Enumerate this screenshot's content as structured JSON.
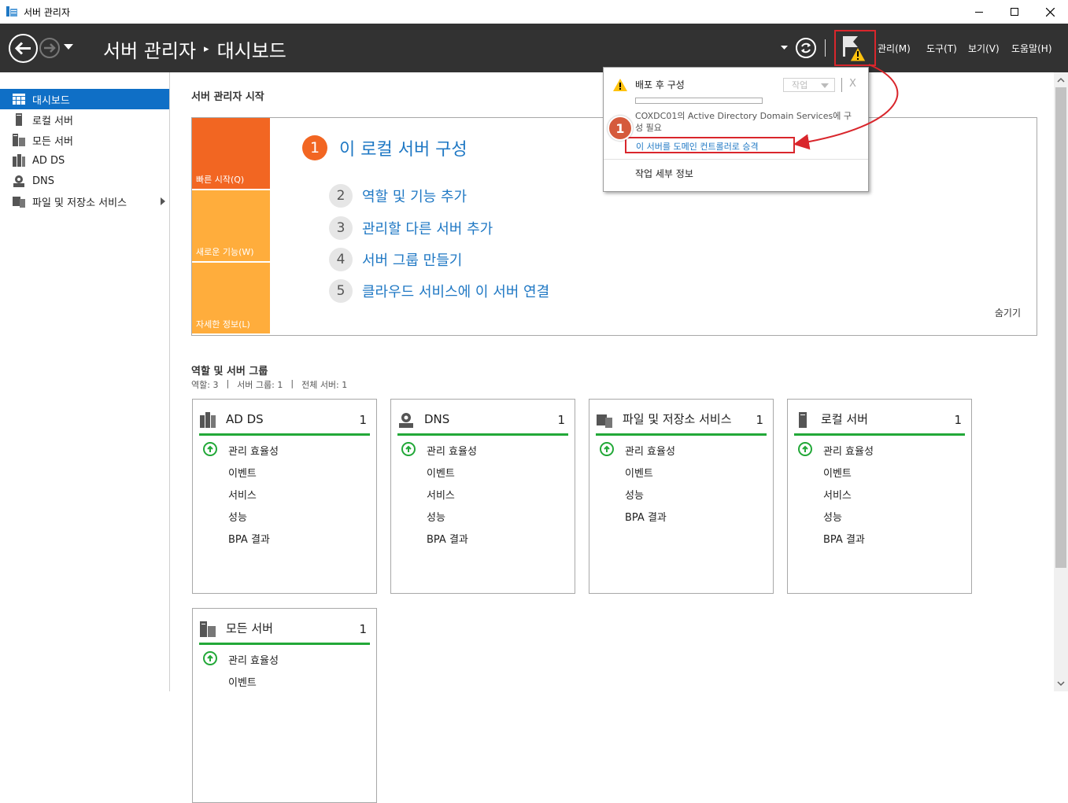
{
  "window": {
    "title": "서버 관리자",
    "minimize_icon": "minimize-icon",
    "maximize_icon": "maximize-icon",
    "close_icon": "close-icon"
  },
  "header": {
    "breadcrumb_root": "서버 관리자",
    "breadcrumb_separator": "▸",
    "breadcrumb_current": "대시보드",
    "menus": [
      "관리(M)",
      "도구(T)",
      "보기(V)",
      "도움말(H)"
    ],
    "background_color": "#323232"
  },
  "sidebar": {
    "items": [
      {
        "label": "대시보드",
        "icon": "dashboard-icon",
        "active": true
      },
      {
        "label": "로컬 서버",
        "icon": "local-server-icon",
        "active": false
      },
      {
        "label": "모든 서버",
        "icon": "all-servers-icon",
        "active": false
      },
      {
        "label": "AD DS",
        "icon": "ad-ds-icon",
        "active": false
      },
      {
        "label": "DNS",
        "icon": "dns-icon",
        "active": false
      },
      {
        "label": "파일 및 저장소 서비스",
        "icon": "file-storage-icon",
        "active": false
      }
    ],
    "active_color": "#0f6fc6"
  },
  "welcome": {
    "heading": "서버 관리자 시작",
    "tiles": {
      "quick_start": "빠른 시작(Q)",
      "whats_new": "새로운 기능(W)",
      "learn_more": "자세한 정보(L)"
    },
    "step1": {
      "num": "1",
      "label": "이 로컬 서버 구성"
    },
    "steps": [
      {
        "num": "2",
        "label": "역할 및 기능 추가"
      },
      {
        "num": "3",
        "label": "관리할 다른 서버 추가"
      },
      {
        "num": "4",
        "label": "서버 그룹 만들기"
      },
      {
        "num": "5",
        "label": "클라우드 서비스에 이 서버 연결"
      }
    ],
    "hide": "숨기기"
  },
  "roles": {
    "heading": "역할 및 서버 그룹",
    "summary": [
      "역할: 3",
      "|",
      "서버 그룹: 1",
      "|",
      "전체 서버: 1"
    ],
    "cards": [
      {
        "title": "AD DS",
        "count": "1",
        "icon": "ad-ds-icon",
        "rows": [
          "관리 효율성",
          "이벤트",
          "서비스",
          "성능",
          "BPA 결과"
        ]
      },
      {
        "title": "DNS",
        "count": "1",
        "icon": "dns-icon",
        "rows": [
          "관리 효율성",
          "이벤트",
          "서비스",
          "성능",
          "BPA 결과"
        ]
      },
      {
        "title": "파일 및 저장소 서비스",
        "count": "1",
        "icon": "file-storage-icon",
        "rows": [
          "관리 효율성",
          "이벤트",
          "성능",
          "BPA 결과"
        ]
      },
      {
        "title": "로컬 서버",
        "count": "1",
        "icon": "local-server-icon",
        "rows": [
          "관리 효율성",
          "이벤트",
          "서비스",
          "성능",
          "BPA 결과"
        ]
      },
      {
        "title": "모든 서버",
        "count": "1",
        "icon": "all-servers-icon",
        "rows": [
          "관리 효율성",
          "이벤트"
        ]
      }
    ],
    "status_color": "#22a838"
  },
  "notification": {
    "title": "배포 후 구성",
    "task_button": "작업",
    "close": "X",
    "message": "COXDC01의 Active Directory Domain Services에 구성 필요",
    "promote_link": "이 서버를 도메인 컨트롤러로 승격",
    "details": "작업 세부 정보",
    "badge": "1",
    "highlight_color": "#d9262c"
  }
}
